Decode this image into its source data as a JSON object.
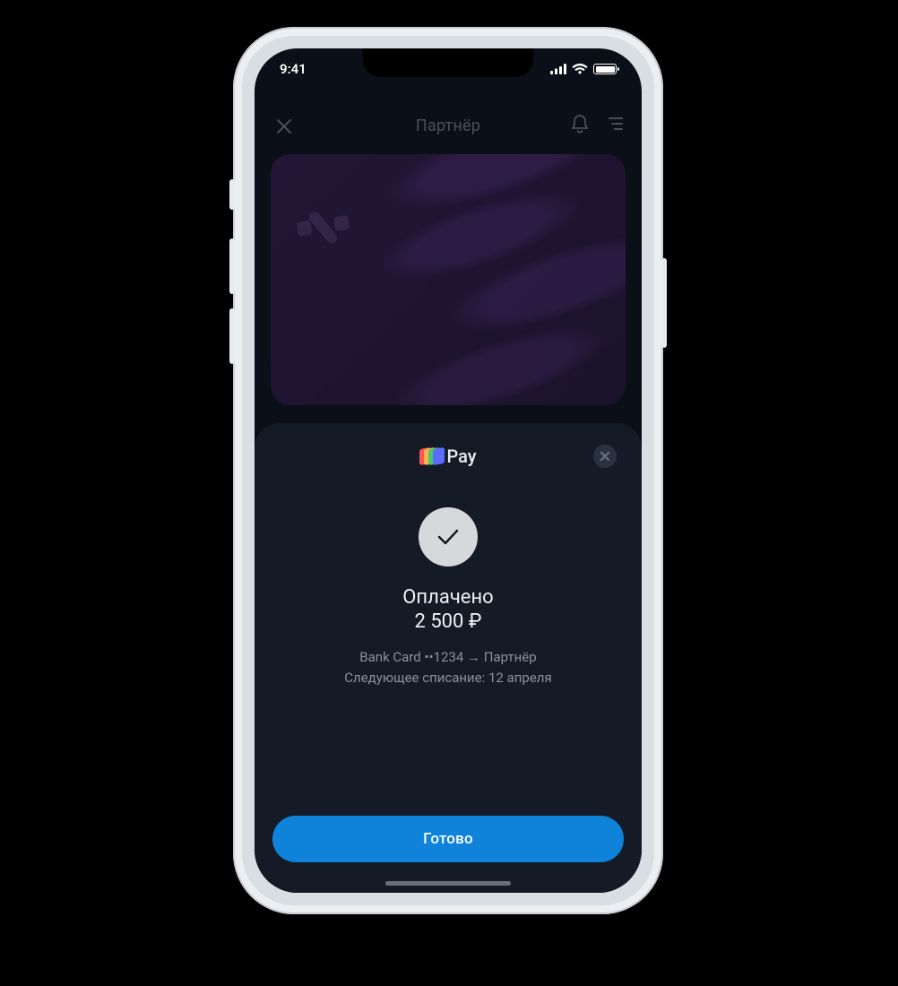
{
  "status_bar": {
    "time": "9:41"
  },
  "app_bar": {
    "title": "Партнёр"
  },
  "sheet": {
    "brand": "Pay",
    "status_title": "Оплачено",
    "amount": "2 500 ₽",
    "transfer_line": "Bank Card ••1234 → Партнёр",
    "next_charge_line": "Следующее списание: 12 апреля",
    "done_label": "Готово"
  }
}
